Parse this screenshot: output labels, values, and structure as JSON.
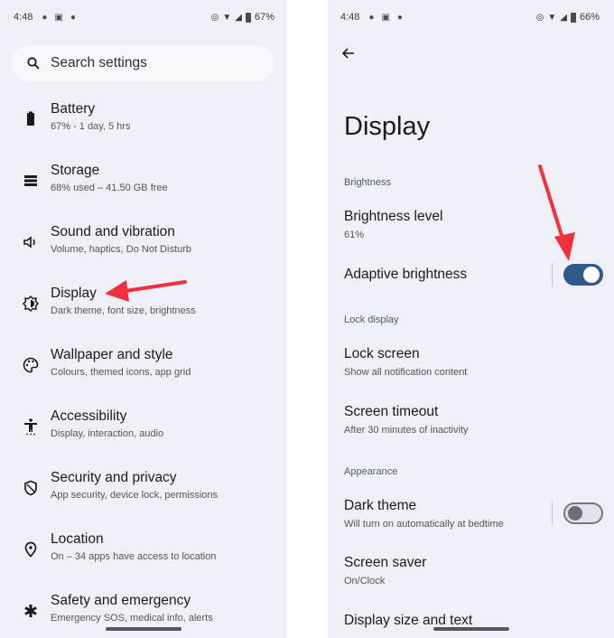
{
  "left_screen": {
    "status_bar": {
      "time": "4:48",
      "battery": "67%",
      "icons": [
        "chat-icon",
        "notification-icon",
        "location-icon",
        "vibrate-icon",
        "wifi-icon",
        "signal-icon",
        "battery-icon"
      ]
    },
    "search": {
      "placeholder": "Search settings",
      "icon": "search-icon"
    },
    "items": [
      {
        "title": "Battery",
        "subtitle": "67% - 1 day, 5 hrs",
        "icon": "battery-icon"
      },
      {
        "title": "Storage",
        "subtitle": "68% used – 41.50 GB free",
        "icon": "storage-icon"
      },
      {
        "title": "Sound and vibration",
        "subtitle": "Volume, haptics, Do Not Disturb",
        "icon": "volume-icon"
      },
      {
        "title": "Display",
        "subtitle": "Dark theme, font size, brightness",
        "icon": "brightness-icon"
      },
      {
        "title": "Wallpaper and style",
        "subtitle": "Colours, themed icons, app grid",
        "icon": "palette-icon"
      },
      {
        "title": "Accessibility",
        "subtitle": "Display, interaction, audio",
        "icon": "accessibility-icon"
      },
      {
        "title": "Security and privacy",
        "subtitle": "App security, device lock, permissions",
        "icon": "shield-icon"
      },
      {
        "title": "Location",
        "subtitle": "On – 34 apps have access to location",
        "icon": "location-pin-icon"
      },
      {
        "title": "Safety and emergency",
        "subtitle": "Emergency SOS, medical info, alerts",
        "icon": "asterisk-icon"
      }
    ]
  },
  "right_screen": {
    "status_bar": {
      "time": "4:48",
      "battery": "66%"
    },
    "title": "Display",
    "sections": {
      "brightness": "Brightness",
      "lock_display": "Lock display",
      "appearance": "Appearance"
    },
    "prefs": {
      "brightness_level": {
        "title": "Brightness level",
        "subtitle": "61%"
      },
      "adaptive_brightness": {
        "title": "Adaptive brightness",
        "enabled": true
      },
      "lock_screen": {
        "title": "Lock screen",
        "subtitle": "Show all notification content"
      },
      "screen_timeout": {
        "title": "Screen timeout",
        "subtitle": "After 30 minutes of inactivity"
      },
      "dark_theme": {
        "title": "Dark theme",
        "subtitle": "Will turn on automatically at bedtime",
        "enabled": false
      },
      "screen_saver": {
        "title": "Screen saver",
        "subtitle": "On/Clock"
      },
      "display_size": {
        "title": "Display size and text"
      }
    }
  },
  "colors": {
    "background": "#eeeff7",
    "accent_switch": "#2f5a8a",
    "annotation_arrow": "#f0303f",
    "section_header": "#4f5b6e"
  }
}
